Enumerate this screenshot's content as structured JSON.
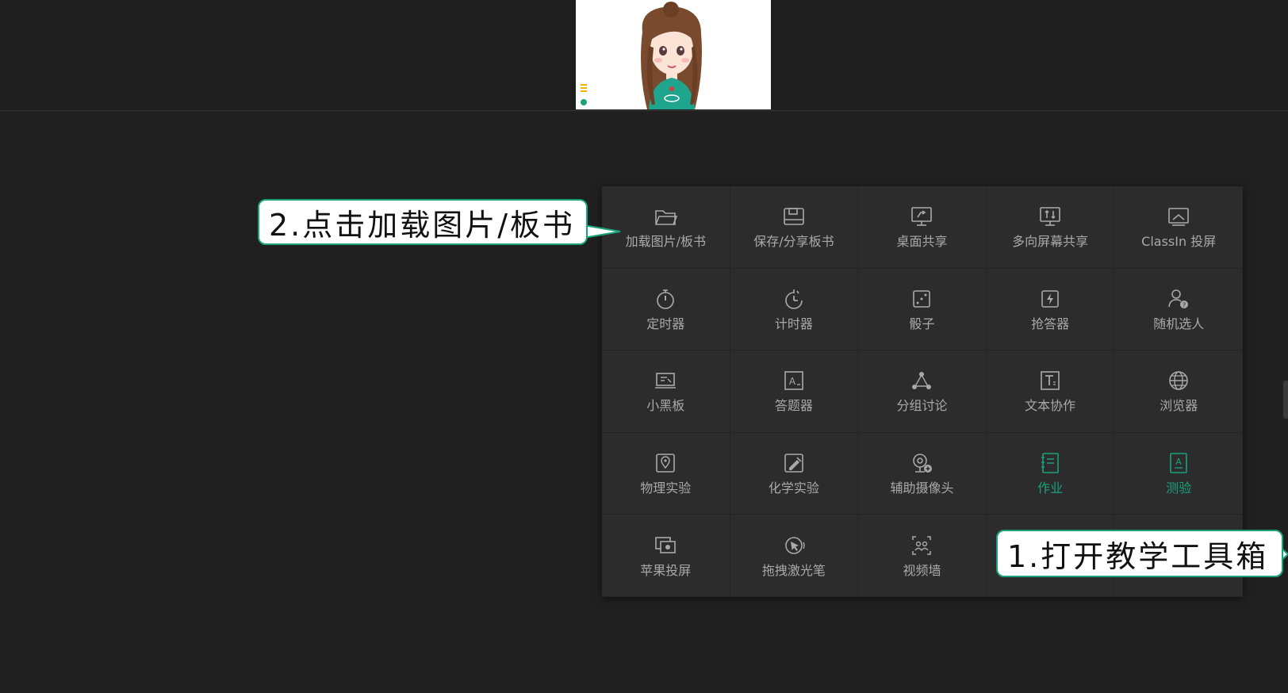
{
  "toolbox": {
    "items": [
      {
        "label": "加载图片/板书",
        "icon": "folder-open-icon"
      },
      {
        "label": "保存/分享板书",
        "icon": "save-icon"
      },
      {
        "label": "桌面共享",
        "icon": "desktop-share-icon"
      },
      {
        "label": "多向屏幕共享",
        "icon": "multi-screen-share-icon"
      },
      {
        "label": "ClassIn 投屏",
        "icon": "cast-screen-icon"
      },
      {
        "label": "定时器",
        "icon": "timer-icon"
      },
      {
        "label": "计时器",
        "icon": "stopwatch-icon"
      },
      {
        "label": "骰子",
        "icon": "dice-icon"
      },
      {
        "label": "抢答器",
        "icon": "buzzer-icon"
      },
      {
        "label": "随机选人",
        "icon": "random-person-icon"
      },
      {
        "label": "小黑板",
        "icon": "small-blackboard-icon"
      },
      {
        "label": "答题器",
        "icon": "answer-card-icon"
      },
      {
        "label": "分组讨论",
        "icon": "group-discussion-icon"
      },
      {
        "label": "文本协作",
        "icon": "text-collab-icon"
      },
      {
        "label": "浏览器",
        "icon": "globe-icon"
      },
      {
        "label": "物理实验",
        "icon": "physics-lab-icon"
      },
      {
        "label": "化学实验",
        "icon": "chemistry-lab-icon"
      },
      {
        "label": "辅助摄像头",
        "icon": "aux-camera-icon"
      },
      {
        "label": "作业",
        "icon": "homework-icon"
      },
      {
        "label": "测验",
        "icon": "quiz-icon"
      },
      {
        "label": "苹果投屏",
        "icon": "apple-cast-icon"
      },
      {
        "label": "拖拽激光笔",
        "icon": "laser-pointer-icon"
      },
      {
        "label": "视频墙",
        "icon": "video-wall-icon"
      }
    ]
  },
  "callouts": {
    "step2": "2.点击加载图片/板书",
    "step1": "1.打开教学工具箱"
  },
  "colors": {
    "background": "#202020",
    "panel": "#2c2c2c",
    "text": "#a9a9a9",
    "accent": "#1aa37a"
  }
}
